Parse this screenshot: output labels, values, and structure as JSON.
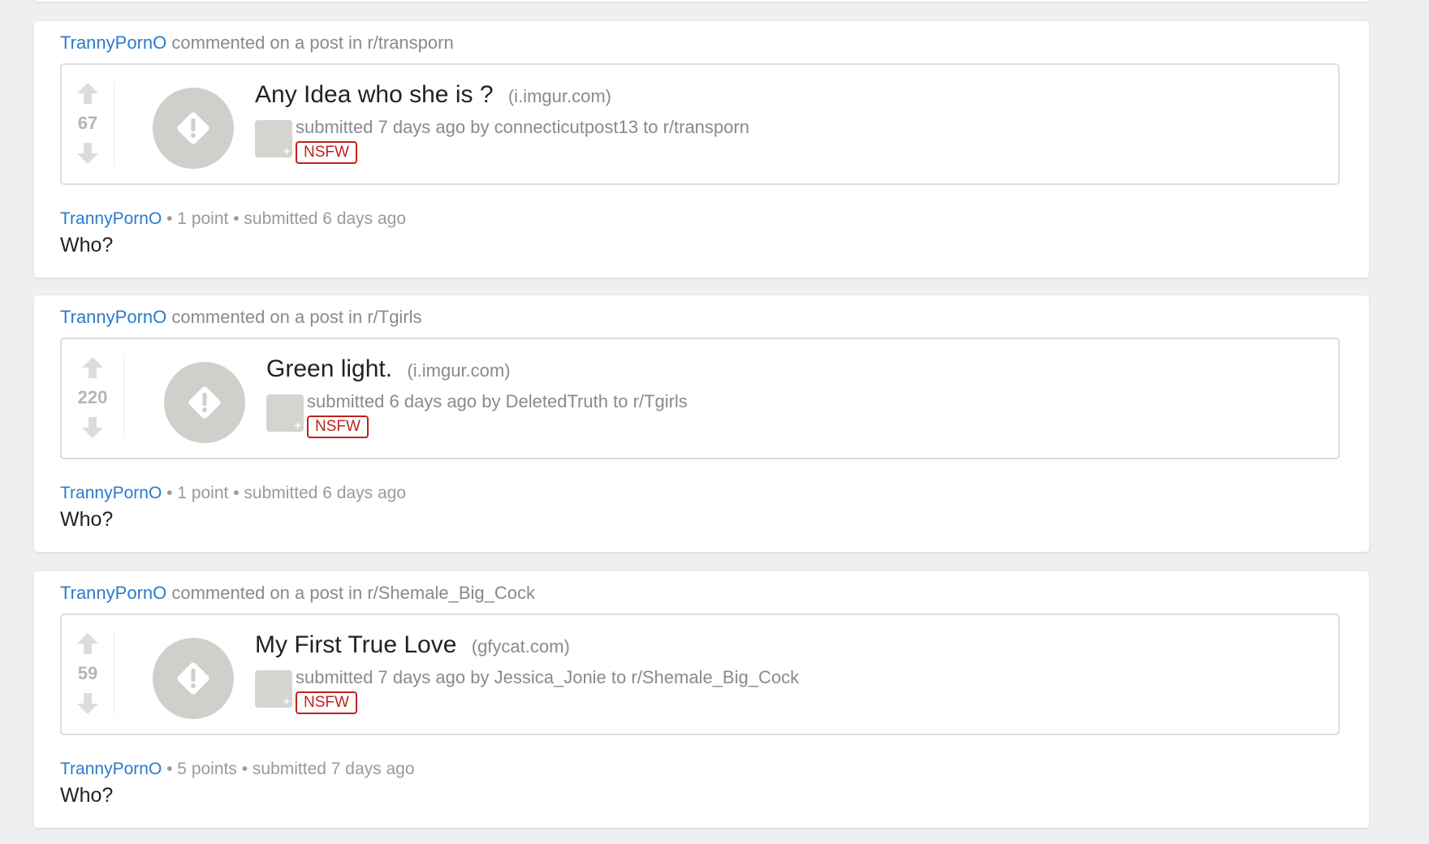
{
  "activity": [
    {
      "user": "TrannyPornO",
      "header_text": "commented on a post in",
      "subreddit": "r/transporn",
      "post": {
        "score": "67",
        "title": "Any Idea who she is ?",
        "domain": "(i.imgur.com)",
        "submitted_prefix": "submitted 7 days ago by",
        "author": "connecticutpost13",
        "to_text": "to",
        "subreddit": "r/transporn",
        "tag": "NSFW"
      },
      "comment": {
        "author": "TrannyPornO",
        "meta": "• 1 point • submitted 6 days ago",
        "body": "Who?"
      }
    },
    {
      "user": "TrannyPornO",
      "header_text": "commented on a post in",
      "subreddit": "r/Tgirls",
      "post": {
        "score": "220",
        "title": "Green light.",
        "domain": "(i.imgur.com)",
        "submitted_prefix": "submitted 6 days ago by",
        "author": "DeletedTruth",
        "to_text": "to",
        "subreddit": "r/Tgirls",
        "tag": "NSFW"
      },
      "comment": {
        "author": "TrannyPornO",
        "meta": "• 1 point • submitted 6 days ago",
        "body": "Who?"
      }
    },
    {
      "user": "TrannyPornO",
      "header_text": "commented on a post in",
      "subreddit": "r/Shemale_Big_Cock",
      "post": {
        "score": "59",
        "title": "My First True Love",
        "domain": "(gfycat.com)",
        "submitted_prefix": "submitted 7 days ago by",
        "author": "Jessica_Jonie",
        "to_text": "to",
        "subreddit": "r/Shemale_Big_Cock",
        "tag": "NSFW"
      },
      "comment": {
        "author": "TrannyPornO",
        "meta": "• 5 points • submitted 7 days ago",
        "body": "Who?"
      }
    }
  ],
  "colors": {
    "background": "#edeff1",
    "link_blue": "#2b7bce",
    "nsfw_red": "#c0211c",
    "muted_text": "#8a8a8a",
    "thumbnail_gray": "#cfcfcb"
  },
  "icons": [
    "upvote-arrow-icon",
    "downvote-arrow-icon",
    "warning-icon",
    "expand-icon"
  ]
}
